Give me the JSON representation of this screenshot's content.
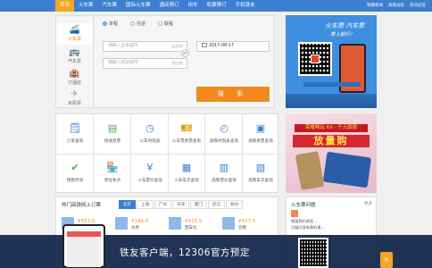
{
  "nav": {
    "items": [
      "首页",
      "火车票",
      "汽车票",
      "国际火车票",
      "酒店预订",
      "用车",
      "机票预订",
      "手机铁友"
    ],
    "right": [
      "铁路新闻",
      "高铁动车",
      "有问必答"
    ]
  },
  "sidebar": {
    "items": [
      "火车票",
      "汽车票",
      "订酒店",
      "买机票"
    ]
  },
  "search": {
    "radios": [
      "单程",
      "往返",
      "联程"
    ],
    "from_placeholder": "请输入出发城市",
    "from_tag": "出发地",
    "to_placeholder": "请输入到达城市",
    "to_tag": "到达地",
    "date": "2017-08-17",
    "swap": "⇄",
    "button": "搜 索"
  },
  "qr_ad": {
    "line1": "火车票 汽车票",
    "line2": "掌上都行！"
  },
  "services": [
    {
      "label": "订单查询",
      "icon": "order-icon"
    },
    {
      "label": "快速退票",
      "icon": "refund-icon"
    },
    {
      "label": "火车时刻表",
      "icon": "timetable-icon"
    },
    {
      "label": "火车票余票查询",
      "icon": "ticket-icon"
    },
    {
      "label": "高铁时刻表查询",
      "icon": "highspeed-icon"
    },
    {
      "label": "高铁余票查询",
      "icon": "hsticket-icon"
    },
    {
      "label": "预售时间",
      "icon": "presale-icon"
    },
    {
      "label": "责任免点",
      "icon": "agency-icon"
    },
    {
      "label": "火车票价查询",
      "icon": "price-icon"
    },
    {
      "label": "火车车次查询",
      "icon": "train-no-icon"
    },
    {
      "label": "高铁票价查询",
      "icon": "hs-price-icon"
    },
    {
      "label": "高铁车次查询",
      "icon": "hs-no-icon"
    }
  ],
  "ad_phone": {
    "brand": "荣耀畅玩 6X · 千元旗舰",
    "headline": "荣耀畅玩 6X · 千元旗舰",
    "big": "放量购"
  },
  "hot": {
    "title": "热门高铁网上订票",
    "cities": [
      "北京",
      "上海",
      "广州",
      "天津",
      "厦门",
      "武汉",
      "杭州"
    ],
    "routes": [
      {
        "price": "¥553.0",
        "dest": "上海虹桥"
      },
      {
        "price": "¥194.0",
        "dest": "太原"
      },
      {
        "price": "¥515.5",
        "dest": "西安北"
      },
      {
        "price": "¥427.5",
        "dest": "合肥"
      }
    ]
  },
  "faq": {
    "title": "火车票问题",
    "more": "更多",
    "line1": "铁路预约改签 …",
    "line2": "贝疑问答车票的事…"
  },
  "banner": {
    "text": "铁友客户端，12306官方预定",
    "close": "×"
  }
}
